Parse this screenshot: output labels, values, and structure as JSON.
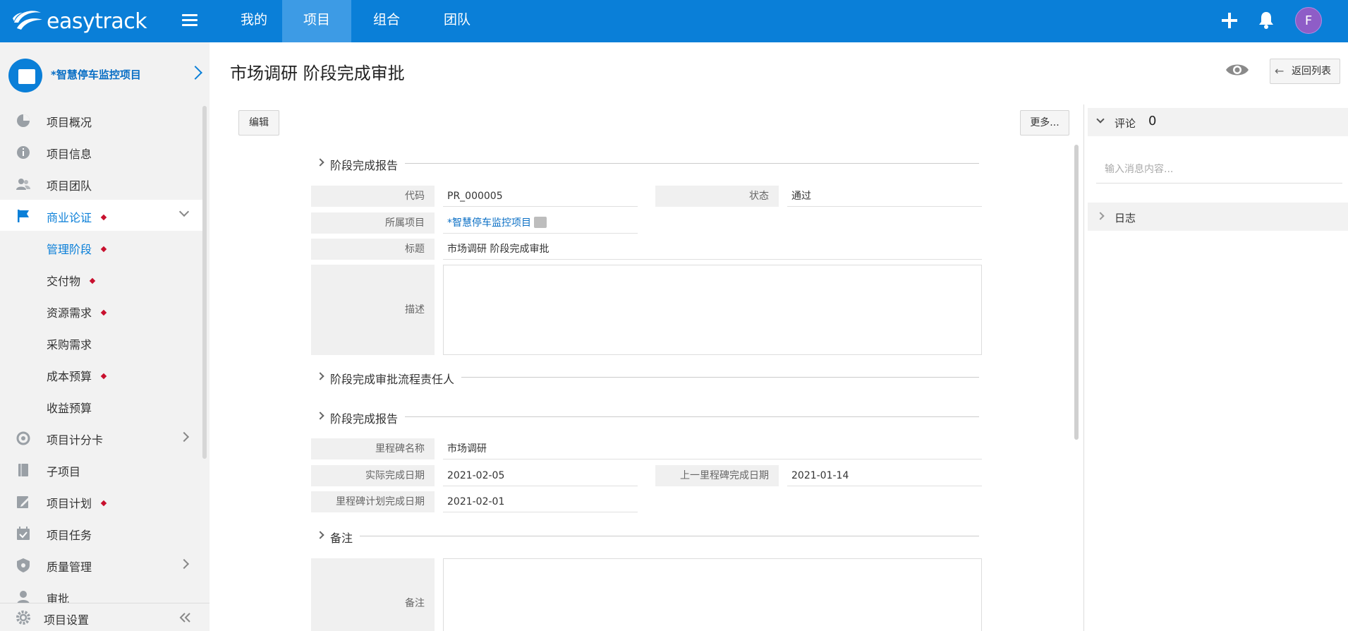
{
  "app": {
    "logo_text": "easytrack",
    "avatar_initial": "F"
  },
  "topnav": {
    "tabs": [
      {
        "label": "我的"
      },
      {
        "label": "项目"
      },
      {
        "label": "组合"
      },
      {
        "label": "团队"
      }
    ],
    "active_tab": "项目"
  },
  "sidebar": {
    "project_name": "*智慧停车监控项目",
    "items": [
      {
        "label": "项目概况",
        "icon": "pie-chart-icon"
      },
      {
        "label": "项目信息",
        "icon": "info-icon"
      },
      {
        "label": "项目团队",
        "icon": "team-icon"
      },
      {
        "label": "商业论证",
        "icon": "flag-icon",
        "marked": true,
        "expanded": true
      },
      {
        "label": "管理阶段",
        "marked": true,
        "sub": true,
        "active": true
      },
      {
        "label": "交付物",
        "marked": true,
        "sub": true
      },
      {
        "label": "资源需求",
        "marked": true,
        "sub": true
      },
      {
        "label": "采购需求",
        "sub": true
      },
      {
        "label": "成本预算",
        "marked": true,
        "sub": true
      },
      {
        "label": "收益预算",
        "sub": true
      },
      {
        "label": "项目计分卡",
        "icon": "target-icon",
        "has_children": true
      },
      {
        "label": "子项目",
        "icon": "book-icon"
      },
      {
        "label": "项目计划",
        "icon": "plan-icon",
        "marked": true
      },
      {
        "label": "项目任务",
        "icon": "calendar-check-icon"
      },
      {
        "label": "质量管理",
        "icon": "shield-icon",
        "has_children": true
      },
      {
        "label": "审批",
        "icon": "user-icon"
      }
    ],
    "footer_label": "项目设置"
  },
  "page": {
    "title": "市场调研 阶段完成审批",
    "back_label": "返回列表",
    "edit_label": "编辑",
    "more_label": "更多..."
  },
  "form": {
    "section1_title": "阶段完成报告",
    "code_label": "代码",
    "code_value": "PR_000005",
    "status_label": "状态",
    "status_value": "通过",
    "project_label": "所属项目",
    "project_value": "*智慧停车监控项目",
    "title_label": "标题",
    "title_value": "市场调研 阶段完成审批",
    "desc_label": "描述",
    "desc_value": "",
    "section2_title": "阶段完成审批流程责任人",
    "section3_title": "阶段完成报告",
    "milestone_label": "里程碑名称",
    "milestone_value": "市场调研",
    "actual_date_label": "实际完成日期",
    "actual_date_value": "2021-02-05",
    "prev_milestone_label": "上一里程碑完成日期",
    "prev_milestone_value": "2021-01-14",
    "planned_date_label": "里程碑计划完成日期",
    "planned_date_value": "2021-02-01",
    "section4_title": "备注",
    "remark_label": "备注",
    "remark_value": ""
  },
  "right_panel": {
    "comments_title": "评论",
    "comments_count": "0",
    "comment_placeholder": "输入消息内容...",
    "log_title": "日志"
  },
  "colors": {
    "brand": "#0a7fd8",
    "nav_active": "#3d9be5",
    "marker": "#c8102e",
    "link": "#0a6fc5",
    "avatar": "#8e5dc7"
  }
}
